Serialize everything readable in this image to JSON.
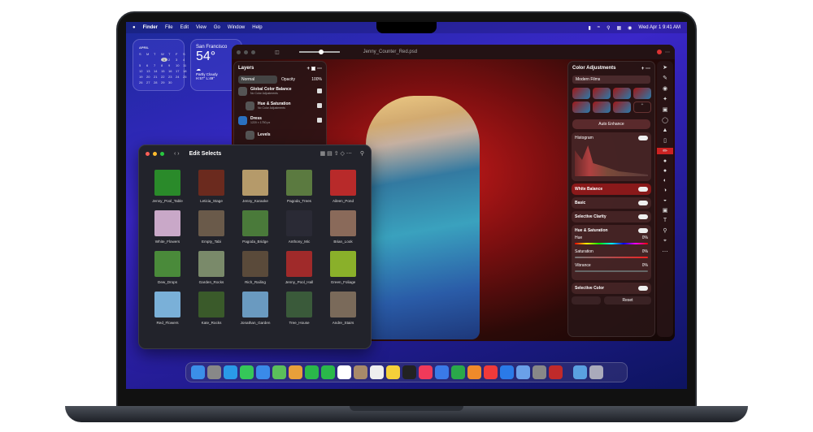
{
  "menubar": {
    "apple": "",
    "app": "Finder",
    "items": [
      "File",
      "Edit",
      "View",
      "Go",
      "Window",
      "Help"
    ],
    "datetime": "Wed Apr 1  9:41 AM"
  },
  "calendar": {
    "month": "APRIL",
    "days": [
      "S",
      "M",
      "T",
      "W",
      "T",
      "F",
      "S",
      "",
      "",
      "",
      "1",
      "2",
      "3",
      "4",
      "5",
      "6",
      "7",
      "8",
      "9",
      "10",
      "11",
      "12",
      "13",
      "14",
      "15",
      "16",
      "17",
      "18",
      "19",
      "20",
      "21",
      "22",
      "23",
      "24",
      "25",
      "26",
      "27",
      "28",
      "29",
      "30"
    ],
    "today": "1"
  },
  "weather": {
    "city": "San Francisco",
    "temp": "54°",
    "condition": "Partly Cloudy",
    "range": "H:57° L:49°"
  },
  "editor": {
    "filename": "Jenny_Counter_Red.psd",
    "layers": {
      "title": "Layers",
      "blend": "Normal",
      "opacity_label": "Opacity",
      "opacity": "100%",
      "items": [
        {
          "name": "Global Color Balance",
          "detail": "No Color Adjustments"
        },
        {
          "name": "Hue & Saturation",
          "detail": "No Color Adjustments"
        },
        {
          "name": "Dress",
          "detail": "1220 × 1750 px"
        },
        {
          "name": "Levels",
          "detail": ""
        }
      ]
    },
    "adjust": {
      "title": "Color Adjustments",
      "preset": "Modern Films",
      "auto": "Auto Enhance",
      "histogram": "Histogram",
      "sections": [
        "White Balance",
        "Basic",
        "Selective Clarity"
      ],
      "hs": {
        "title": "Hue & Saturation",
        "hue": "Hue",
        "hue_val": "0%",
        "sat": "Saturation",
        "sat_val": "0%",
        "vib": "Vibrance",
        "vib_val": "0%"
      },
      "selective_color": "Selective Color",
      "reset": "Reset"
    }
  },
  "finder": {
    "title": "Edit Selects",
    "items": [
      "Jenny_Pool_Table",
      "Leticia_Stage",
      "Jenny_Karaoke",
      "Pagoda_Trees",
      "Aileen_Pond",
      "White_Flowers",
      "Empty_Tabi",
      "Pagoda_Bridge",
      "Anthony_Mic",
      "Brian_Look",
      "Dew_Drops",
      "Garden_Rocks",
      "Rich_Railing",
      "Jenny_Pool_Hall",
      "Green_Foliage",
      "Red_Flowers",
      "Kate_Rocks",
      "Jonathan_Garden",
      "Tree_House",
      "Andre_Stairs"
    ],
    "colors": [
      "#2a8a2a",
      "#6b2a1e",
      "#b59a6a",
      "#5b7a40",
      "#b82a2a",
      "#c9a8c8",
      "#6a5a4a",
      "#4a7a3a",
      "#2a2a35",
      "#8a6a5a",
      "#4a8a3a",
      "#7a8a6a",
      "#5a4a3a",
      "#a02a2a",
      "#8ab02a",
      "#7ab0d8",
      "#3a5a2a",
      "#6a9ac0",
      "#3a5a3a",
      "#7a6a5a"
    ]
  },
  "dock": {
    "apps": [
      "Finder",
      "Launchpad",
      "Safari",
      "Messages",
      "Mail",
      "Maps",
      "Photos",
      "FaceTime",
      "Phone",
      "Calendar",
      "Contacts",
      "Reminders",
      "Notes",
      "TV",
      "Music",
      "Keynote",
      "Numbers",
      "Pages",
      "News",
      "App Store",
      "Preview",
      "System Settings",
      "Photo Editor",
      "Downloads",
      "Trash"
    ],
    "colors": [
      "#3b8fe8",
      "#888",
      "#2a9ae8",
      "#35c759",
      "#3a8ae8",
      "#5bbf5b",
      "#e8a03a",
      "#2ab84a",
      "#2ab84a",
      "#fff",
      "#a88a6a",
      "#eee",
      "#f5d03a",
      "#222",
      "#f03a5a",
      "#3a7ae8",
      "#2aa84a",
      "#f08a2a",
      "#f03a3a",
      "#2a7ae8",
      "#6aa0e8",
      "#888",
      "#c02a2a",
      "#5aa0e0",
      "#aab"
    ]
  }
}
